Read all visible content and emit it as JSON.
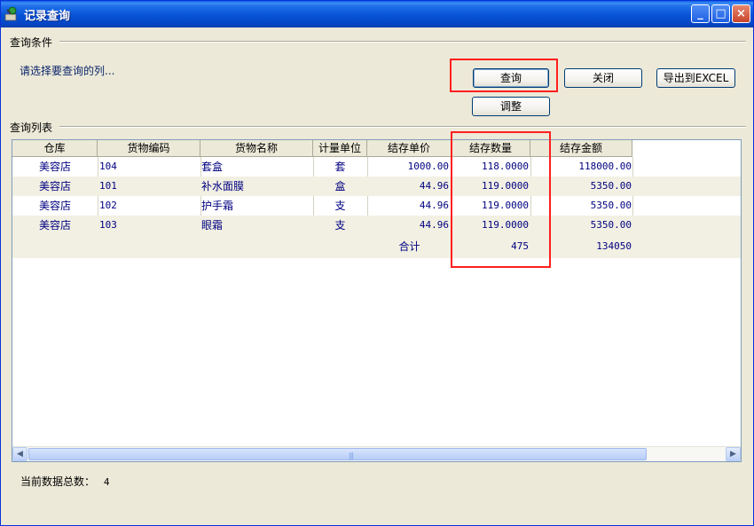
{
  "window": {
    "title": "记录查询",
    "controls": {
      "minimize": "_",
      "maximize": "□",
      "close": "×"
    }
  },
  "query_group": {
    "label": "查询条件",
    "hint": "请选择要查询的列..."
  },
  "buttons": {
    "query": "查询",
    "close": "关闭",
    "export": "导出到EXCEL",
    "adjust": "调整"
  },
  "list_group": {
    "label": "查询列表"
  },
  "table": {
    "columns": [
      "仓库",
      "货物编码",
      "货物名称",
      "计量单位",
      "结存单价",
      "结存数量",
      "结存金额"
    ],
    "rows": [
      [
        "美容店",
        "104",
        "套盒",
        "套",
        "1000.00",
        "118.0000",
        "118000.00"
      ],
      [
        "美容店",
        "101",
        "补水面膜",
        "盒",
        "44.96",
        "119.0000",
        "5350.00"
      ],
      [
        "美容店",
        "102",
        "护手霜",
        "支",
        "44.96",
        "119.0000",
        "5350.00"
      ],
      [
        "美容店",
        "103",
        "眼霜",
        "支",
        "44.96",
        "119.0000",
        "5350.00"
      ]
    ],
    "total": {
      "label": "合计",
      "quantity": "475",
      "amount": "134050"
    }
  },
  "status": {
    "label": "当前数据总数：",
    "count": "4"
  },
  "colors": {
    "titlebar": "#0752d6",
    "highlight": "#ff1f1f",
    "cell_text": "#000080",
    "window_bg": "#ece9d8"
  }
}
